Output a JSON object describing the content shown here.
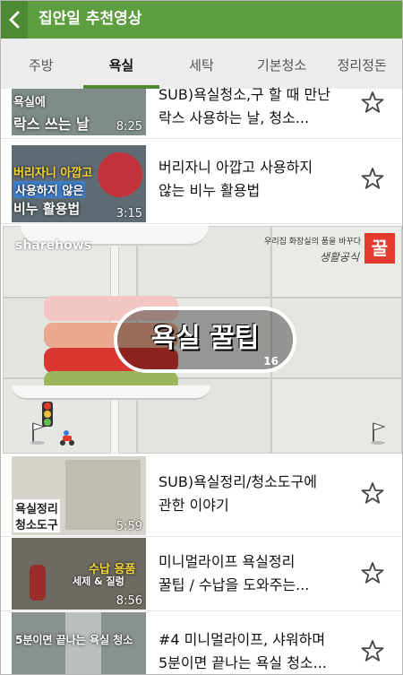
{
  "header": {
    "title": "집안일 추천영상"
  },
  "tabs": [
    {
      "label": "주방"
    },
    {
      "label": "욕실"
    },
    {
      "label": "세탁"
    },
    {
      "label": "기본청소"
    },
    {
      "label": "정리정돈"
    }
  ],
  "videos_top": [
    {
      "title": "SUB)욕실청소,구 할 때 만난 락스 사용하는 날, 청소...",
      "title_lines": [
        "SUB)욕실청소,구 할 때 만난",
        "락스 사용하는 날, 청소..."
      ],
      "duration": "8:25",
      "thumb_lines": [
        "욕실에",
        "락스 쓰는 날"
      ]
    },
    {
      "title": "버리자니 아깝고 사용하지 않는 비누 활용법",
      "title_lines": [
        "버리자니 아깝고 사용하지",
        "않는 비누 활용법"
      ],
      "duration": "3:15",
      "thumb_lines": [
        "버리자니 아깝고",
        "사용하지 않은",
        "비누 활용법"
      ]
    }
  ],
  "featured": {
    "logo": "sharehows",
    "brand_tagline": "우리집 화장실의 품을 바꾸다",
    "brand_name": "생활공식",
    "brand_mark": "꿀",
    "badge_text": "욕실 꿀팁",
    "badge_number": "16"
  },
  "videos_bottom": [
    {
      "title_lines": [
        "SUB)욕실정리/청소도구에",
        "관한 이야기"
      ],
      "duration": "5:59",
      "thumb_lines": [
        "욕실정리",
        "청소도구"
      ]
    },
    {
      "title_lines": [
        "미니멀라이프 욕실정리",
        "꿀팁 / 수납을 도와주는..."
      ],
      "duration": "8:56",
      "thumb_lines": [
        "수납 용품",
        "세제 & 질렁"
      ]
    },
    {
      "title_lines": [
        "#4  미니멀라이프, 샤워하며",
        "5분이면 끝나는 욕실 청소..."
      ],
      "duration": "",
      "thumb_lines": [
        "5분이면 끝나는 욕실 청소"
      ]
    }
  ],
  "colors": {
    "header_green": "#5d9e41",
    "tab_indicator": "#4b8a33",
    "tab_bg": "#ececec"
  }
}
